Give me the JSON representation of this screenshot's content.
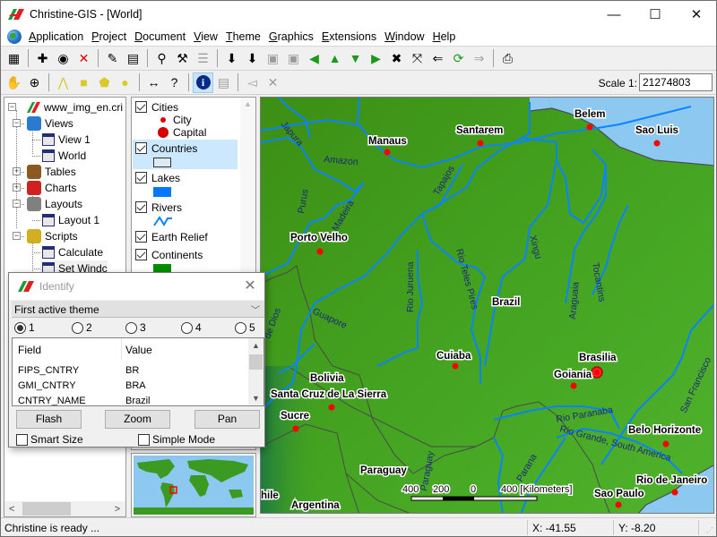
{
  "window": {
    "title": "Christine-GIS - [World]",
    "controls": {
      "minimize": "—",
      "maximize": "☐",
      "close": "✕"
    }
  },
  "menubar": {
    "items": [
      {
        "label": "Application",
        "accel": "A",
        "rest": "pplication"
      },
      {
        "label": "Project",
        "accel": "P",
        "rest": "roject"
      },
      {
        "label": "Document",
        "accel": "D",
        "rest": "ocument"
      },
      {
        "label": "View",
        "accel": "V",
        "rest": "iew"
      },
      {
        "label": "Theme",
        "accel": "T",
        "rest": "heme"
      },
      {
        "label": "Graphics",
        "accel": "G",
        "rest": "raphics"
      },
      {
        "label": "Extensions",
        "accel": "E",
        "rest": "xtensions"
      },
      {
        "label": "Window",
        "accel": "W",
        "rest": "indow"
      },
      {
        "label": "Help",
        "accel": "H",
        "rest": "elp"
      }
    ],
    "mdi_controls": {
      "minimize": "_",
      "restore": "❐",
      "close": "✕"
    }
  },
  "toolbar1": {
    "buttons": [
      {
        "name": "new-view",
        "glyph": "▦"
      },
      {
        "name": "add-theme",
        "glyph": "✚"
      },
      {
        "name": "add-image-theme",
        "glyph": "◉"
      },
      {
        "name": "delete-theme",
        "glyph": "✕"
      },
      {
        "name": "theme-properties",
        "glyph": "✎"
      },
      {
        "name": "open-table",
        "glyph": "▤"
      },
      {
        "name": "find",
        "glyph": "⚲"
      },
      {
        "name": "query-builder",
        "glyph": "⚒"
      },
      {
        "name": "legend-editor",
        "glyph": "☰",
        "disabled": true
      },
      {
        "name": "themes-on",
        "glyph": "⬇"
      },
      {
        "name": "themes-off",
        "glyph": "⬇"
      },
      {
        "name": "hotlink",
        "glyph": "▣",
        "disabled": true
      },
      {
        "name": "label-themes",
        "glyph": "▣",
        "disabled": true
      },
      {
        "name": "zoom-previous",
        "glyph": "◀"
      },
      {
        "name": "move-up",
        "glyph": "▲"
      },
      {
        "name": "move-down",
        "glyph": "▼"
      },
      {
        "name": "zoom-next",
        "glyph": "▶"
      },
      {
        "name": "zoom-in-fixed",
        "glyph": "✖"
      },
      {
        "name": "zoom-out-fixed",
        "glyph": "⤧"
      },
      {
        "name": "zoom-to-selected",
        "glyph": "⇐"
      },
      {
        "name": "refresh",
        "glyph": "⟳"
      },
      {
        "name": "zoom-to-extent",
        "glyph": "⇒",
        "disabled": true
      },
      {
        "name": "print",
        "glyph": "⎙"
      }
    ]
  },
  "toolbar2": {
    "buttons": [
      {
        "name": "pan",
        "glyph": "✋"
      },
      {
        "name": "zoom-in",
        "glyph": "⊕"
      },
      {
        "name": "select-line",
        "glyph": "⋀"
      },
      {
        "name": "select-rectangle",
        "glyph": "■"
      },
      {
        "name": "select-polygon",
        "glyph": "⬟"
      },
      {
        "name": "select-circle",
        "glyph": "●"
      },
      {
        "name": "measure",
        "glyph": "↔"
      },
      {
        "name": "hotlink-tool",
        "glyph": "?"
      },
      {
        "name": "identify",
        "glyph": "i",
        "active": true
      },
      {
        "name": "add-label",
        "glyph": "▤",
        "disabled": true
      },
      {
        "name": "edit-label",
        "glyph": "◅",
        "disabled": true
      },
      {
        "name": "delete-label",
        "glyph": "✕",
        "disabled": true
      }
    ],
    "scale_label": "Scale 1:",
    "scale_value": "21274803"
  },
  "project_tree": {
    "root": "www_img_en.cri",
    "nodes": [
      {
        "label": "Views",
        "level": 1,
        "expanded": true
      },
      {
        "label": "View 1",
        "level": 2
      },
      {
        "label": "World",
        "level": 2
      },
      {
        "label": "Tables",
        "level": 1,
        "expanded": false
      },
      {
        "label": "Charts",
        "level": 1,
        "expanded": false
      },
      {
        "label": "Layouts",
        "level": 1,
        "expanded": true
      },
      {
        "label": "Layout 1",
        "level": 2
      },
      {
        "label": "Scripts",
        "level": 1,
        "expanded": true
      },
      {
        "label": "Calculate",
        "level": 2
      },
      {
        "label": "Set Windc",
        "level": 2
      }
    ]
  },
  "legend": {
    "themes": [
      {
        "name": "Cities",
        "checked": true,
        "symbols": [
          {
            "label": "City"
          },
          {
            "label": "Capital"
          }
        ]
      },
      {
        "name": "Countries",
        "checked": true,
        "selected": true
      },
      {
        "name": "Lakes",
        "checked": true,
        "color": "#0078ff"
      },
      {
        "name": "Rivers",
        "checked": true,
        "color": "#0a84ff"
      },
      {
        "name": "Earth Relief",
        "checked": true
      },
      {
        "name": "Continents",
        "checked": true,
        "color": "#008c00"
      }
    ]
  },
  "identify": {
    "title": "Identify",
    "close": "✕",
    "mode_select": "First active theme",
    "radios": [
      {
        "label": "1",
        "selected": true
      },
      {
        "label": "2",
        "selected": false
      },
      {
        "label": "3",
        "selected": false
      },
      {
        "label": "4",
        "selected": false
      },
      {
        "label": "5",
        "selected": false
      }
    ],
    "columns": [
      "Field",
      "Value"
    ],
    "rows": [
      {
        "field": "FIPS_CNTRY",
        "value": "BR"
      },
      {
        "field": "GMI_CNTRY",
        "value": "BRA"
      },
      {
        "field": "CNTRY_NAME",
        "value": "Brazil"
      }
    ],
    "buttons": {
      "flash": "Flash",
      "zoom": "Zoom",
      "pan": "Pan"
    },
    "options": {
      "smart_size": "Smart Size",
      "simple_mode": "Simple Mode"
    }
  },
  "map": {
    "cities": [
      {
        "name": "Manaus"
      },
      {
        "name": "Santarem"
      },
      {
        "name": "Belem"
      },
      {
        "name": "Sao Luis"
      },
      {
        "name": "Porto Velho"
      },
      {
        "name": "Cuiaba"
      },
      {
        "name": "Brasilia"
      },
      {
        "name": "Goiania"
      },
      {
        "name": "Santa Cruz de La Sierra"
      },
      {
        "name": "Sucre"
      },
      {
        "name": "Belo Horizonte"
      },
      {
        "name": "Rio de Janeiro"
      },
      {
        "name": "Sao Paulo"
      }
    ],
    "countries": [
      "Brazil",
      "Bolivia",
      "Paraguay",
      "Argentina",
      "hile"
    ],
    "rivers": [
      "Japura",
      "Amazon",
      "Purus",
      "Madeira",
      "Tapajos",
      "Xingu",
      "Rio Juruena",
      "Rio Teles Pires",
      "Araguaia",
      "Tocantins",
      "Guapore",
      "de Dios",
      "San Francisco",
      "Rio Paranaba",
      "Rio Grande, South America",
      "Parana",
      "Paraguay"
    ],
    "scalebar": {
      "ticks": [
        "400",
        "200",
        "0",
        "400 [Kilometers]"
      ]
    }
  },
  "status": {
    "message": "Christine is ready ...",
    "x": "X: -41.55",
    "y": "Y: -8.20"
  },
  "colors": {
    "land": "#3f9a1f",
    "river": "#0a84ff",
    "ocean": "#8cc8f0",
    "city": "#ff0000",
    "selection": "#cce8ff"
  }
}
